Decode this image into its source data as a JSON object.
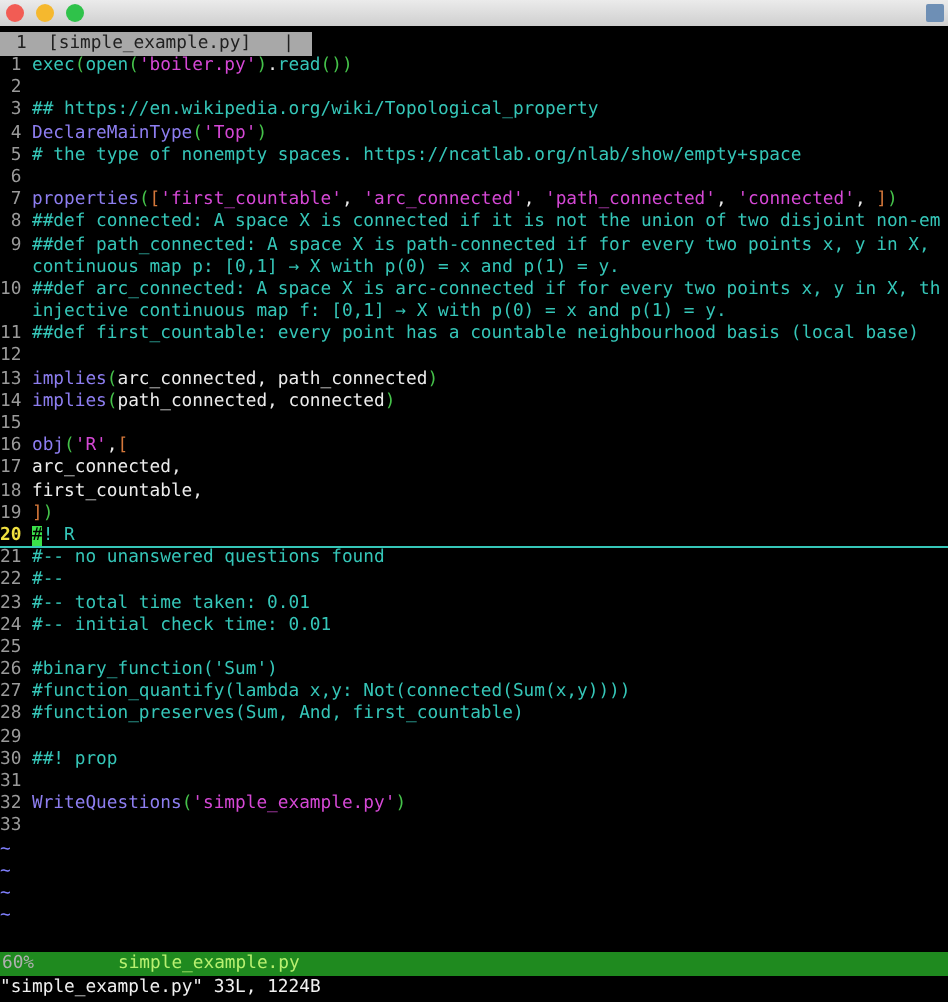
{
  "tabline": {
    "number": "1",
    "label": "[simple_example.py]",
    "separator": "|"
  },
  "rows": [
    {
      "kind": "line",
      "number": "1",
      "tokens": [
        {
          "kind": "builtin",
          "text": "exec"
        },
        {
          "kind": "paren",
          "text": "("
        },
        {
          "kind": "builtin",
          "text": "open"
        },
        {
          "kind": "paren",
          "text": "("
        },
        {
          "kind": "string",
          "text": "'boiler.py'"
        },
        {
          "kind": "paren",
          "text": ")"
        },
        {
          "kind": "plain",
          "text": "."
        },
        {
          "kind": "builtin",
          "text": "read"
        },
        {
          "kind": "paren",
          "text": "())"
        }
      ]
    },
    {
      "kind": "line",
      "number": "2"
    },
    {
      "kind": "line",
      "number": "3",
      "tokens": [
        {
          "kind": "comment",
          "text": "## https://en.wikipedia.org/wiki/Topological_property"
        }
      ]
    },
    {
      "kind": "line",
      "number": "4",
      "tokens": [
        {
          "kind": "func",
          "text": "DeclareMainType"
        },
        {
          "kind": "paren",
          "text": "("
        },
        {
          "kind": "string",
          "text": "'Top'"
        },
        {
          "kind": "paren",
          "text": ")"
        }
      ]
    },
    {
      "kind": "line",
      "number": "5",
      "tokens": [
        {
          "kind": "comment",
          "text": "# the type of nonempty spaces. https://ncatlab.org/nlab/show/empty+space"
        }
      ]
    },
    {
      "kind": "line",
      "number": "6"
    },
    {
      "kind": "line",
      "number": "7",
      "tokens": [
        {
          "kind": "func",
          "text": "properties"
        },
        {
          "kind": "paren",
          "text": "("
        },
        {
          "kind": "bracket",
          "text": "["
        },
        {
          "kind": "string",
          "text": "'first_countable'"
        },
        {
          "kind": "plain",
          "text": ", "
        },
        {
          "kind": "string",
          "text": "'arc_connected'"
        },
        {
          "kind": "plain",
          "text": ", "
        },
        {
          "kind": "string",
          "text": "'path_connected'"
        },
        {
          "kind": "plain",
          "text": ", "
        },
        {
          "kind": "string",
          "text": "'connected'"
        },
        {
          "kind": "plain",
          "text": ", "
        },
        {
          "kind": "bracket",
          "text": "]"
        },
        {
          "kind": "paren",
          "text": ")"
        }
      ]
    },
    {
      "kind": "line",
      "number": "8",
      "tokens": [
        {
          "kind": "comment",
          "text": "##def connected: A space X is connected if it is not the union of two disjoint non-em"
        }
      ]
    },
    {
      "kind": "line",
      "number": "9",
      "tokens": [
        {
          "kind": "comment",
          "text": "##def path_connected: A space X is path-connected if for every two points x, y in X,"
        }
      ]
    },
    {
      "kind": "wrap",
      "tokens": [
        {
          "kind": "comment",
          "text": "continuous map p: [0,1] → X with p(0) = x and p(1) = y."
        }
      ]
    },
    {
      "kind": "line",
      "number": "10",
      "tokens": [
        {
          "kind": "comment",
          "text": "##def arc_connected: A space X is arc-connected if for every two points x, y in X, th"
        }
      ]
    },
    {
      "kind": "wrap",
      "tokens": [
        {
          "kind": "comment",
          "text": "injective continuous map f: [0,1] → X with p(0) = x and p(1) = y."
        }
      ]
    },
    {
      "kind": "line",
      "number": "11",
      "tokens": [
        {
          "kind": "comment",
          "text": "##def first_countable: every point has a countable neighbourhood basis (local base)"
        }
      ]
    },
    {
      "kind": "line",
      "number": "12"
    },
    {
      "kind": "line",
      "number": "13",
      "tokens": [
        {
          "kind": "func",
          "text": "implies"
        },
        {
          "kind": "paren",
          "text": "("
        },
        {
          "kind": "plain",
          "text": "arc_connected, path_connected"
        },
        {
          "kind": "paren",
          "text": ")"
        }
      ]
    },
    {
      "kind": "line",
      "number": "14",
      "tokens": [
        {
          "kind": "func",
          "text": "implies"
        },
        {
          "kind": "paren",
          "text": "("
        },
        {
          "kind": "plain",
          "text": "path_connected, connected"
        },
        {
          "kind": "paren",
          "text": ")"
        }
      ]
    },
    {
      "kind": "line",
      "number": "15"
    },
    {
      "kind": "line",
      "number": "16",
      "tokens": [
        {
          "kind": "func",
          "text": "obj"
        },
        {
          "kind": "paren",
          "text": "("
        },
        {
          "kind": "string",
          "text": "'R'"
        },
        {
          "kind": "plain",
          "text": ","
        },
        {
          "kind": "bracket",
          "text": "["
        }
      ]
    },
    {
      "kind": "line",
      "number": "17",
      "tokens": [
        {
          "kind": "plain",
          "text": "arc_connected,"
        }
      ]
    },
    {
      "kind": "line",
      "number": "18",
      "tokens": [
        {
          "kind": "plain",
          "text": "first_countable,"
        }
      ]
    },
    {
      "kind": "line",
      "number": "19",
      "tokens": [
        {
          "kind": "bracket",
          "text": "]"
        },
        {
          "kind": "paren",
          "text": ")"
        }
      ]
    },
    {
      "kind": "cursor",
      "number": "20",
      "tokens": [
        {
          "kind": "comment",
          "text": "#! R"
        }
      ]
    },
    {
      "kind": "line",
      "number": "21",
      "tokens": [
        {
          "kind": "comment",
          "text": "#-- no unanswered questions found"
        }
      ]
    },
    {
      "kind": "line",
      "number": "22",
      "tokens": [
        {
          "kind": "comment",
          "text": "#--"
        }
      ]
    },
    {
      "kind": "line",
      "number": "23",
      "tokens": [
        {
          "kind": "comment",
          "text": "#-- total time taken: 0.01"
        }
      ]
    },
    {
      "kind": "line",
      "number": "24",
      "tokens": [
        {
          "kind": "comment",
          "text": "#-- initial check time: 0.01"
        }
      ]
    },
    {
      "kind": "line",
      "number": "25"
    },
    {
      "kind": "line",
      "number": "26",
      "tokens": [
        {
          "kind": "comment",
          "text": "#binary_function('Sum')"
        }
      ]
    },
    {
      "kind": "line",
      "number": "27",
      "tokens": [
        {
          "kind": "comment",
          "text": "#function_quantify(lambda x,y: Not(connected(Sum(x,y))))"
        }
      ]
    },
    {
      "kind": "line",
      "number": "28",
      "tokens": [
        {
          "kind": "comment",
          "text": "#function_preserves(Sum, And, first_countable)"
        }
      ]
    },
    {
      "kind": "line",
      "number": "29"
    },
    {
      "kind": "line",
      "number": "30",
      "tokens": [
        {
          "kind": "comment",
          "text": "##! prop"
        }
      ]
    },
    {
      "kind": "line",
      "number": "31"
    },
    {
      "kind": "line",
      "number": "32",
      "tokens": [
        {
          "kind": "func",
          "text": "WriteQuestions"
        },
        {
          "kind": "paren",
          "text": "("
        },
        {
          "kind": "string",
          "text": "'simple_example.py'"
        },
        {
          "kind": "paren",
          "text": ")"
        }
      ]
    },
    {
      "kind": "line",
      "number": "33"
    }
  ],
  "filler": [
    "~",
    "~",
    "~",
    "~"
  ],
  "status_bar": {
    "percent": "60%",
    "filename": "simple_example.py"
  },
  "message": "\"simple_example.py\" 33L, 1224B"
}
